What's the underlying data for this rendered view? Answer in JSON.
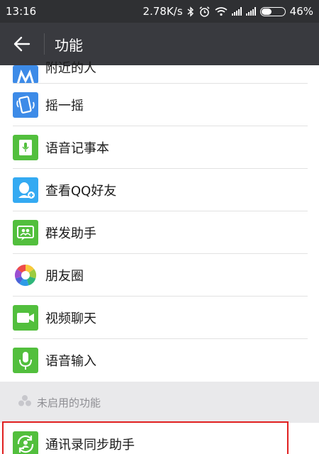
{
  "status": {
    "time": "13:16",
    "speed": "2.78K/s",
    "battery": "46%",
    "battery_level": 0.46
  },
  "appbar": {
    "back_icon": "arrow-left-icon",
    "title": "功能"
  },
  "items": [
    {
      "label": "附近的人",
      "icon": "location-people-icon",
      "color": "#3d8be8"
    },
    {
      "label": "摇一摇",
      "icon": "phone-shake-icon",
      "color": "#3d8be8"
    },
    {
      "label": "语音记事本",
      "icon": "voice-notebook-icon",
      "color": "#52bf3d"
    },
    {
      "label": "查看QQ好友",
      "icon": "qq-friend-icon",
      "color": "#34aaf2"
    },
    {
      "label": "群发助手",
      "icon": "group-message-icon",
      "color": "#52bf3d"
    },
    {
      "label": "朋友圈",
      "icon": "moments-icon",
      "color": "#ffffff"
    },
    {
      "label": "视频聊天",
      "icon": "video-chat-icon",
      "color": "#52bf3d"
    },
    {
      "label": "语音输入",
      "icon": "voice-input-icon",
      "color": "#52bf3d"
    }
  ],
  "section": {
    "label": "未启用的功能",
    "icon": "disabled-features-icon"
  },
  "disabled_items": [
    {
      "label": "通讯录同步助手",
      "icon": "contacts-sync-icon",
      "color": "#52bf3d"
    }
  ],
  "annotation": {
    "highlight_color": "#e02020"
  }
}
